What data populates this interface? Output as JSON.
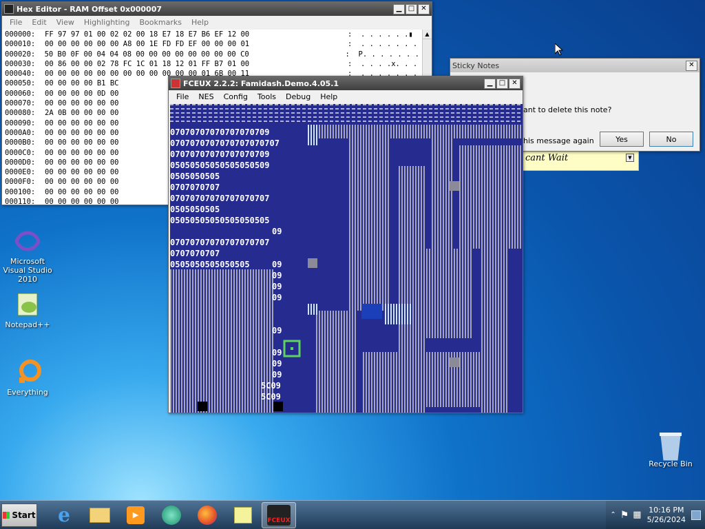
{
  "hex_editor": {
    "title": "Hex Editor - RAM Offset 0x000007",
    "menu": [
      "File",
      "Edit",
      "View",
      "Highlighting",
      "Bookmarks",
      "Help"
    ],
    "rows": [
      {
        "addr": "000000:",
        "bytes": "FF 97 97 01 00 02 02 00 18 E7 18 E7 B6 EF 12 00",
        "ascii": ":  . . . . . .▮"
      },
      {
        "addr": "000010:",
        "bytes": "00 00 00 00 00 00 A8 00 1E FD FD EF 00 00 00 01",
        "ascii": ":  . . . . . . ."
      },
      {
        "addr": "000020:",
        "bytes": "50 B0 0F 00 04 04 08 00 00 00 00 00 00 00 00 C0",
        "ascii": ":  P. . . . . . ."
      },
      {
        "addr": "000030:",
        "bytes": "00 86 00 00 02 78 FC 1C 01 18 12 01 FF B7 01 00",
        "ascii": ":  . . . .x. . ."
      },
      {
        "addr": "000040:",
        "bytes": "00 00 00 00 00 00 00 00 00 00 00 00 01 6B 00 11",
        "ascii": ":  . . . . . . ."
      },
      {
        "addr": "000050:",
        "bytes": "00 00 00 00 B1 BC",
        "ascii": ""
      },
      {
        "addr": "000060:",
        "bytes": "00 00 00 00 0D 00",
        "ascii": ""
      },
      {
        "addr": "000070:",
        "bytes": "00 00 00 00 00 00",
        "ascii": ""
      },
      {
        "addr": "000080:",
        "bytes": "2A 0B 00 00 00 00",
        "ascii": ""
      },
      {
        "addr": "000090:",
        "bytes": "00 00 00 00 00 00",
        "ascii": ""
      },
      {
        "addr": "0000A0:",
        "bytes": "00 00 00 00 00 00",
        "ascii": ""
      },
      {
        "addr": "0000B0:",
        "bytes": "00 00 00 00 00 00",
        "ascii": ""
      },
      {
        "addr": "0000C0:",
        "bytes": "00 00 00 00 00 00",
        "ascii": ""
      },
      {
        "addr": "0000D0:",
        "bytes": "00 00 00 00 00 00",
        "ascii": ""
      },
      {
        "addr": "0000E0:",
        "bytes": "00 00 00 00 00 00",
        "ascii": ""
      },
      {
        "addr": "0000F0:",
        "bytes": "00 00 00 00 00 00",
        "ascii": ""
      },
      {
        "addr": "000100:",
        "bytes": "00 00 00 00 00 00",
        "ascii": ""
      },
      {
        "addr": "000110:",
        "bytes": "00 00 00 00 00 00",
        "ascii": ""
      },
      {
        "addr": "000120:",
        "bytes": "00 00 00 00 00 00",
        "ascii": ""
      }
    ]
  },
  "sticky": {
    "title": "Sticky Notes",
    "question": "ant to delete this note?",
    "checkbox_label": "his message again",
    "yes": "Yes",
    "no": "No",
    "note_text": "cant Wait"
  },
  "fceux": {
    "title": "FCEUX 2.2.2: Famidash.Demo.4.05.1",
    "menu": [
      "File",
      "NES",
      "Config",
      "Tools",
      "Debug",
      "Help"
    ]
  },
  "icons": [
    {
      "label": "Microsoft Visual Studio 2010"
    },
    {
      "label": "Notepad++"
    },
    {
      "label": "Everything"
    },
    {
      "label": "Recycle Bin"
    }
  ],
  "taskbar": {
    "start": "Start",
    "time": "10:16 PM",
    "date": "5/26/2024"
  }
}
